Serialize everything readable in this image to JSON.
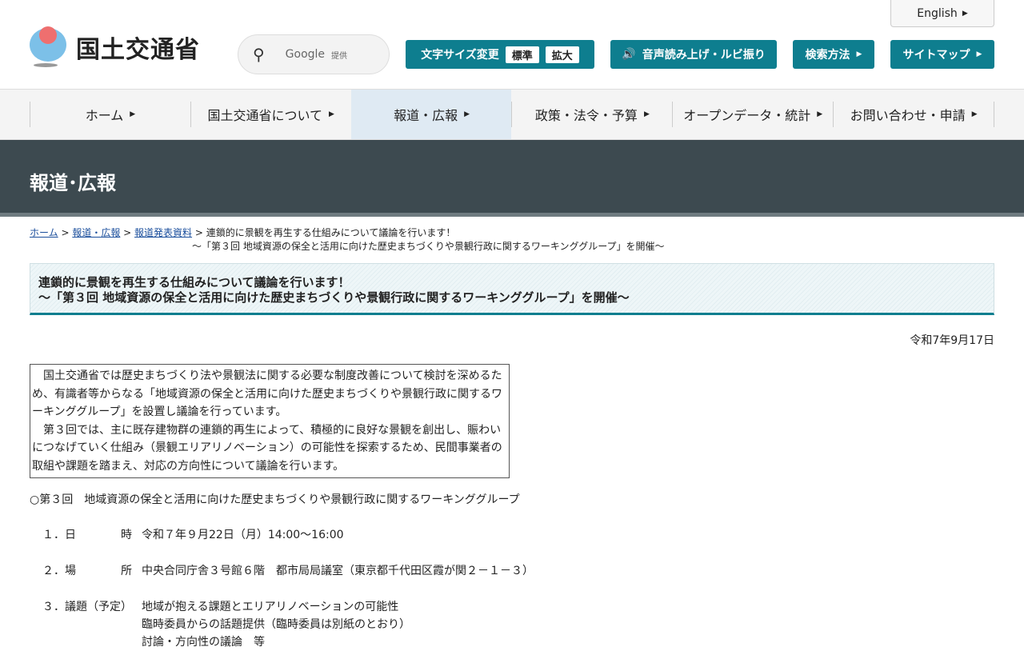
{
  "header": {
    "logo_text": "国土交通省",
    "search_brand": "Google",
    "search_suffix": "提供",
    "english": "English",
    "font_size_label": "文字サイズ変更",
    "font_std": "標準",
    "font_large": "拡大",
    "speech": "音声読み上げ・ルビ振り",
    "search_method": "検索方法",
    "sitemap": "サイトマップ"
  },
  "nav": [
    "ホーム",
    "国土交通省について",
    "報道・広報",
    "政策・法令・予算",
    "オープンデータ・統計",
    "お問い合わせ・申請"
  ],
  "banner": "報道･広報",
  "breadcrumb": {
    "home": "ホーム",
    "press": "報道・広報",
    "releases": "報道発表資料",
    "current1": "連鎖的に景観を再生する仕組みについて議論を行います！",
    "current2": "～「第３回 地域資源の保全と活用に向けた歴史まちづくりや景観行政に関するワーキンググループ」を開催～"
  },
  "title": {
    "line1": "連鎖的に景観を再生する仕組みについて議論を行います！",
    "line2": "～「第３回 地域資源の保全と活用に向けた歴史まちづくりや景観行政に関するワーキンググループ」を開催～"
  },
  "date": "令和7年9月17日",
  "lead": {
    "p1": "　国土交通省では歴史まちづくり法や景観法に関する必要な制度改善について検討を深めるため、有識者等からなる「地域資源の保全と活用に向けた歴史まちづくりや景観行政に関するワーキンググループ」を設置し議論を行っています。",
    "p2": "　第３回では、主に既存建物群の連鎖的再生によって、積極的に良好な景観を創出し、賑わいにつなげていく仕組み（景観エリアリノベーション）の可能性を探索するため、民間事業者の取組や課題を踏まえ、対応の方向性について議論を行います。"
  },
  "meeting_title": "○第３回　地域資源の保全と活用に向けた歴史まちづくりや景観行政に関するワーキンググループ",
  "items": [
    {
      "k": "１．日　　　　時",
      "v": [
        "令和７年９月22日（月）14:00～16:00"
      ]
    },
    {
      "k": "２．場　　　　所",
      "v": [
        "中央合同庁舎３号館６階　都市局局議室（東京都千代田区霞が関２－１－３）"
      ]
    },
    {
      "k": "３．議題（予定）",
      "v": [
        "地域が抱える課題とエリアリノベーションの可能性",
        "臨時委員からの話題提供（臨時委員は別紙のとおり）",
        "討論・方向性の議論　等"
      ]
    }
  ]
}
